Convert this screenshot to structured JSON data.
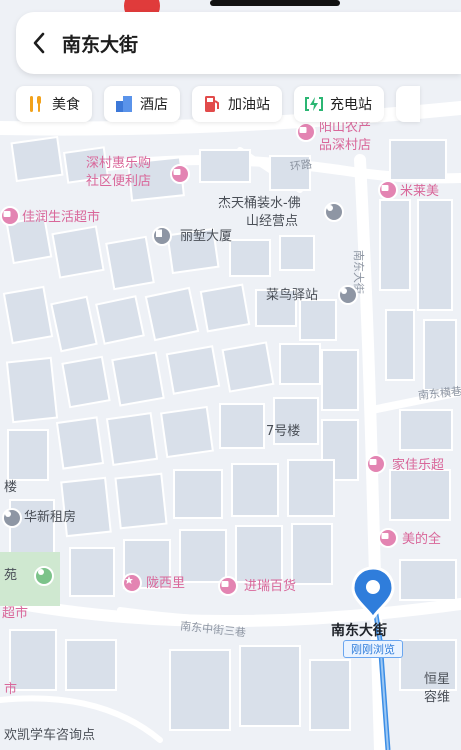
{
  "search": {
    "title": "南东大街",
    "back_icon": "chevron-left-icon"
  },
  "categories": [
    {
      "label": "美食",
      "icon": "fork-knife-icon",
      "color": "#f2a21b"
    },
    {
      "label": "酒店",
      "icon": "hotel-icon",
      "color": "#3c78d8"
    },
    {
      "label": "加油站",
      "icon": "fuel-pump-icon",
      "color": "#e24b4b"
    },
    {
      "label": "充电站",
      "icon": "charging-icon",
      "color": "#2bb673"
    }
  ],
  "pois": {
    "yangshan_store": "阳山农产",
    "yangshan_store_2": "品深村店",
    "shencun_store": "深村惠乐购",
    "shencun_store_2": "社区便利店",
    "jiarun": "佳润生活超市",
    "jietian": "杰天桶装水-佛",
    "jietian_2": "山经营点",
    "milai": "米莱美",
    "lijian": "丽堑大厦",
    "cainiao": "菜鸟驿站",
    "building7": "7号楼",
    "jiajiale": "家佳乐超",
    "huaxin": "华新租房",
    "meide": "美的全",
    "yuan": "苑",
    "longxili": "陇西里",
    "jinrui": "进瑞百货",
    "chaoshi": "超市",
    "shi": "市",
    "hengxing": "恒星",
    "hengxing_2": "容维",
    "huankai": "欢凯学车咨询点",
    "lou": "楼"
  },
  "roads": {
    "nandong_3": "南东中街三巷",
    "nandong_road": "南东横巷",
    "right_road": "南东大街",
    "top_road": "环路"
  },
  "pin": {
    "name": "南东大街",
    "caption": "刚刚浏览",
    "color": "#2f7ddb"
  }
}
